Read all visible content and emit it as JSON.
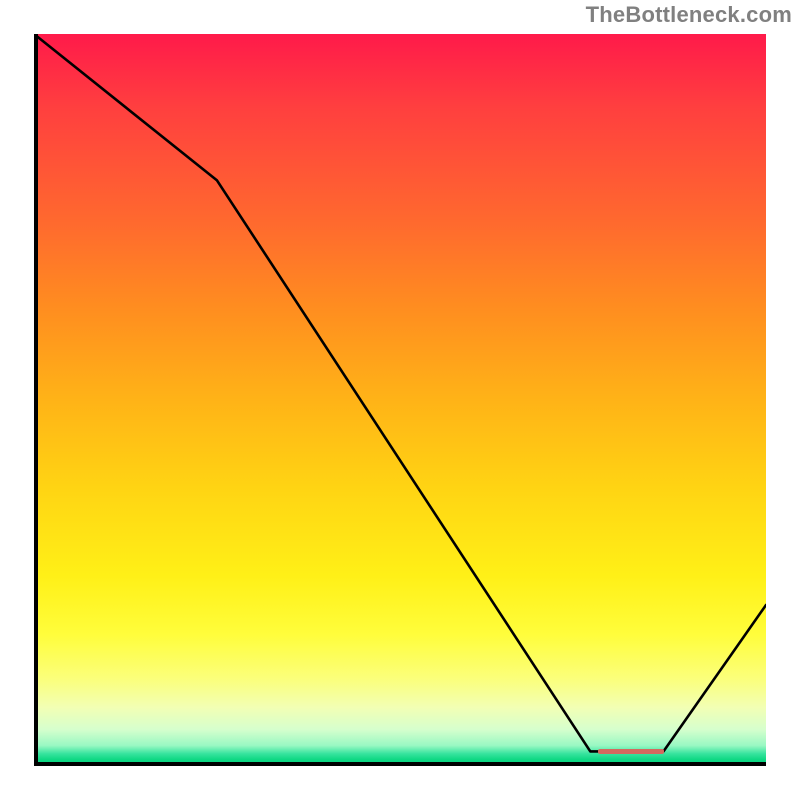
{
  "watermark": "TheBottleneck.com",
  "colors": {
    "line": "#000000",
    "axis": "#000000",
    "marker": "#d46a5f",
    "watermark": "#808080"
  },
  "chart_data": {
    "type": "line",
    "title": "",
    "xlabel": "",
    "ylabel": "",
    "xlim": [
      0,
      100
    ],
    "ylim": [
      0,
      100
    ],
    "grid": false,
    "legend": false,
    "background": "vertical-gradient",
    "line_style": "solid-black",
    "x": [
      0,
      25,
      76,
      86,
      100
    ],
    "y": [
      100,
      80,
      2,
      2,
      22
    ],
    "marker": {
      "x_start": 77,
      "x_end": 86,
      "y": 2
    },
    "notes": "Values estimated from pixel positions; y=0 at chart bottom (green band), y=100 at chart top (red band)."
  }
}
